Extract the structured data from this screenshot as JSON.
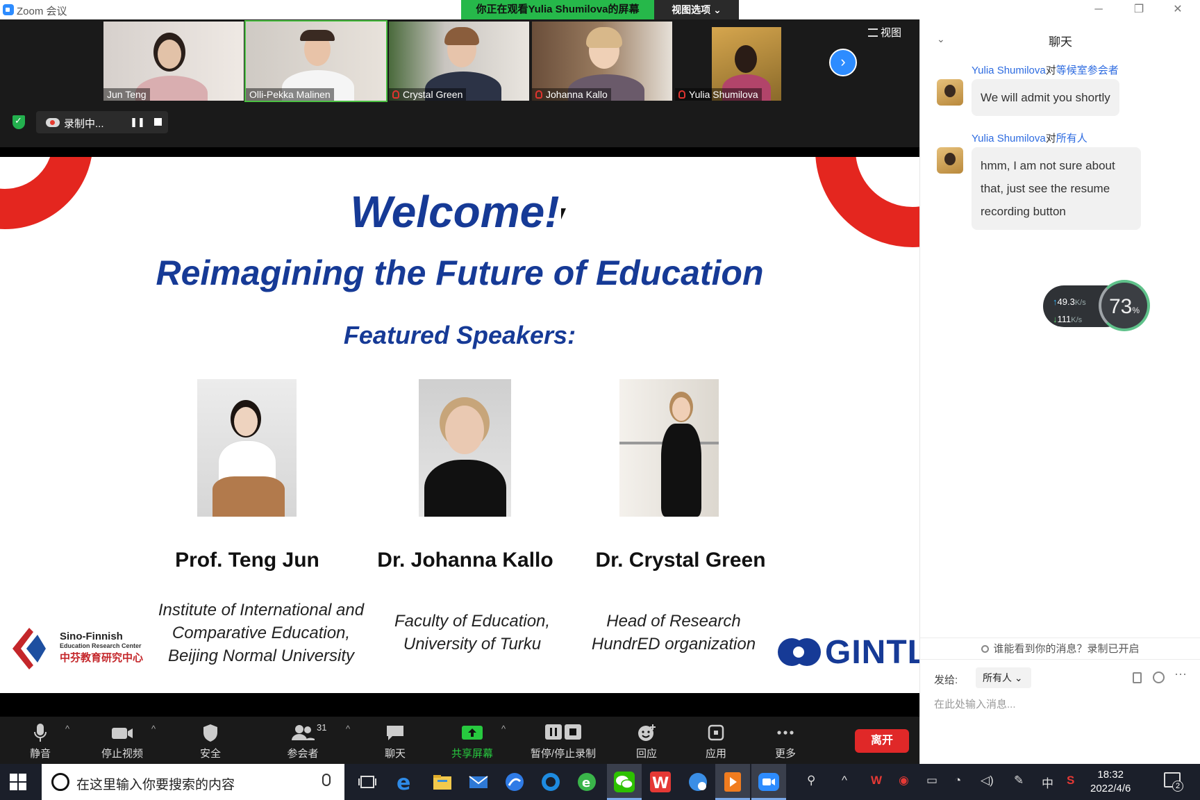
{
  "window": {
    "title": "Zoom 会议",
    "viewing_banner": "你正在观看Yulia Shumilova的屏幕",
    "view_options": "视图选项 ⌄",
    "view_toggle": "视图"
  },
  "participants": [
    {
      "name": "Jun Teng",
      "muted": false
    },
    {
      "name": "Olli-Pekka Malinen",
      "muted": false,
      "active_speaker": true
    },
    {
      "name": "Crystal Green",
      "muted": true
    },
    {
      "name": "Johanna Kallo",
      "muted": true
    },
    {
      "name": "Yulia Shumilova",
      "muted": true
    }
  ],
  "recording": {
    "label": "录制中..."
  },
  "slide": {
    "welcome": "Welcome!",
    "subtitle": "Reimagining the Future of Education",
    "featured": "Featured Speakers:",
    "speakers": [
      {
        "name": "Prof. Teng Jun",
        "affiliation": [
          "Institute of International and",
          "Comparative Education,",
          "Beijing Normal University"
        ]
      },
      {
        "name": "Dr. Johanna Kallo",
        "affiliation": [
          "Faculty of Education,",
          "University of Turku"
        ]
      },
      {
        "name": "Dr. Crystal Green",
        "affiliation": [
          "Head of Research",
          "HundrED organization"
        ]
      }
    ],
    "logo_left": {
      "line1": "Sino-Finnish",
      "line2": "Education Research Center",
      "line3": "中芬教育研究中心"
    },
    "logo_right": "GINTL",
    "accent_red": "#e4261f",
    "accent_blue": "#163a96"
  },
  "toolbar": {
    "mute": "静音",
    "stop_video": "停止视频",
    "security": "安全",
    "participants": "参会者",
    "participants_count": "31",
    "chat": "聊天",
    "share_screen": "共享屏幕",
    "pause_stop_recording": "暂停/停止录制",
    "reactions": "回应",
    "apps": "应用",
    "more": "更多",
    "leave": "离开"
  },
  "chat": {
    "title": "聊天",
    "messages": [
      {
        "sender": "Yulia Shumilova",
        "to_word": "对",
        "recipient": "等候室参会者",
        "text": "We will admit you shortly"
      },
      {
        "sender": "Yulia Shumilova",
        "to_word": "对",
        "recipient": "所有人",
        "text": "hmm, I am not sure about that, just see the resume recording button"
      }
    ],
    "who_sees": "谁能看到你的消息？录制已开启",
    "send_to_label": "发给:",
    "send_to_value": "所有人",
    "input_placeholder": "在此处输入消息..."
  },
  "net_widget": {
    "upload": "49.3",
    "download": "111",
    "unit": "K/s",
    "percent": "73",
    "percent_sign": "%"
  },
  "taskbar": {
    "search_placeholder": "在这里输入你要搜索的内容",
    "ime": "中",
    "time": "18:32",
    "date": "2022/4/6",
    "notifications": "2"
  }
}
